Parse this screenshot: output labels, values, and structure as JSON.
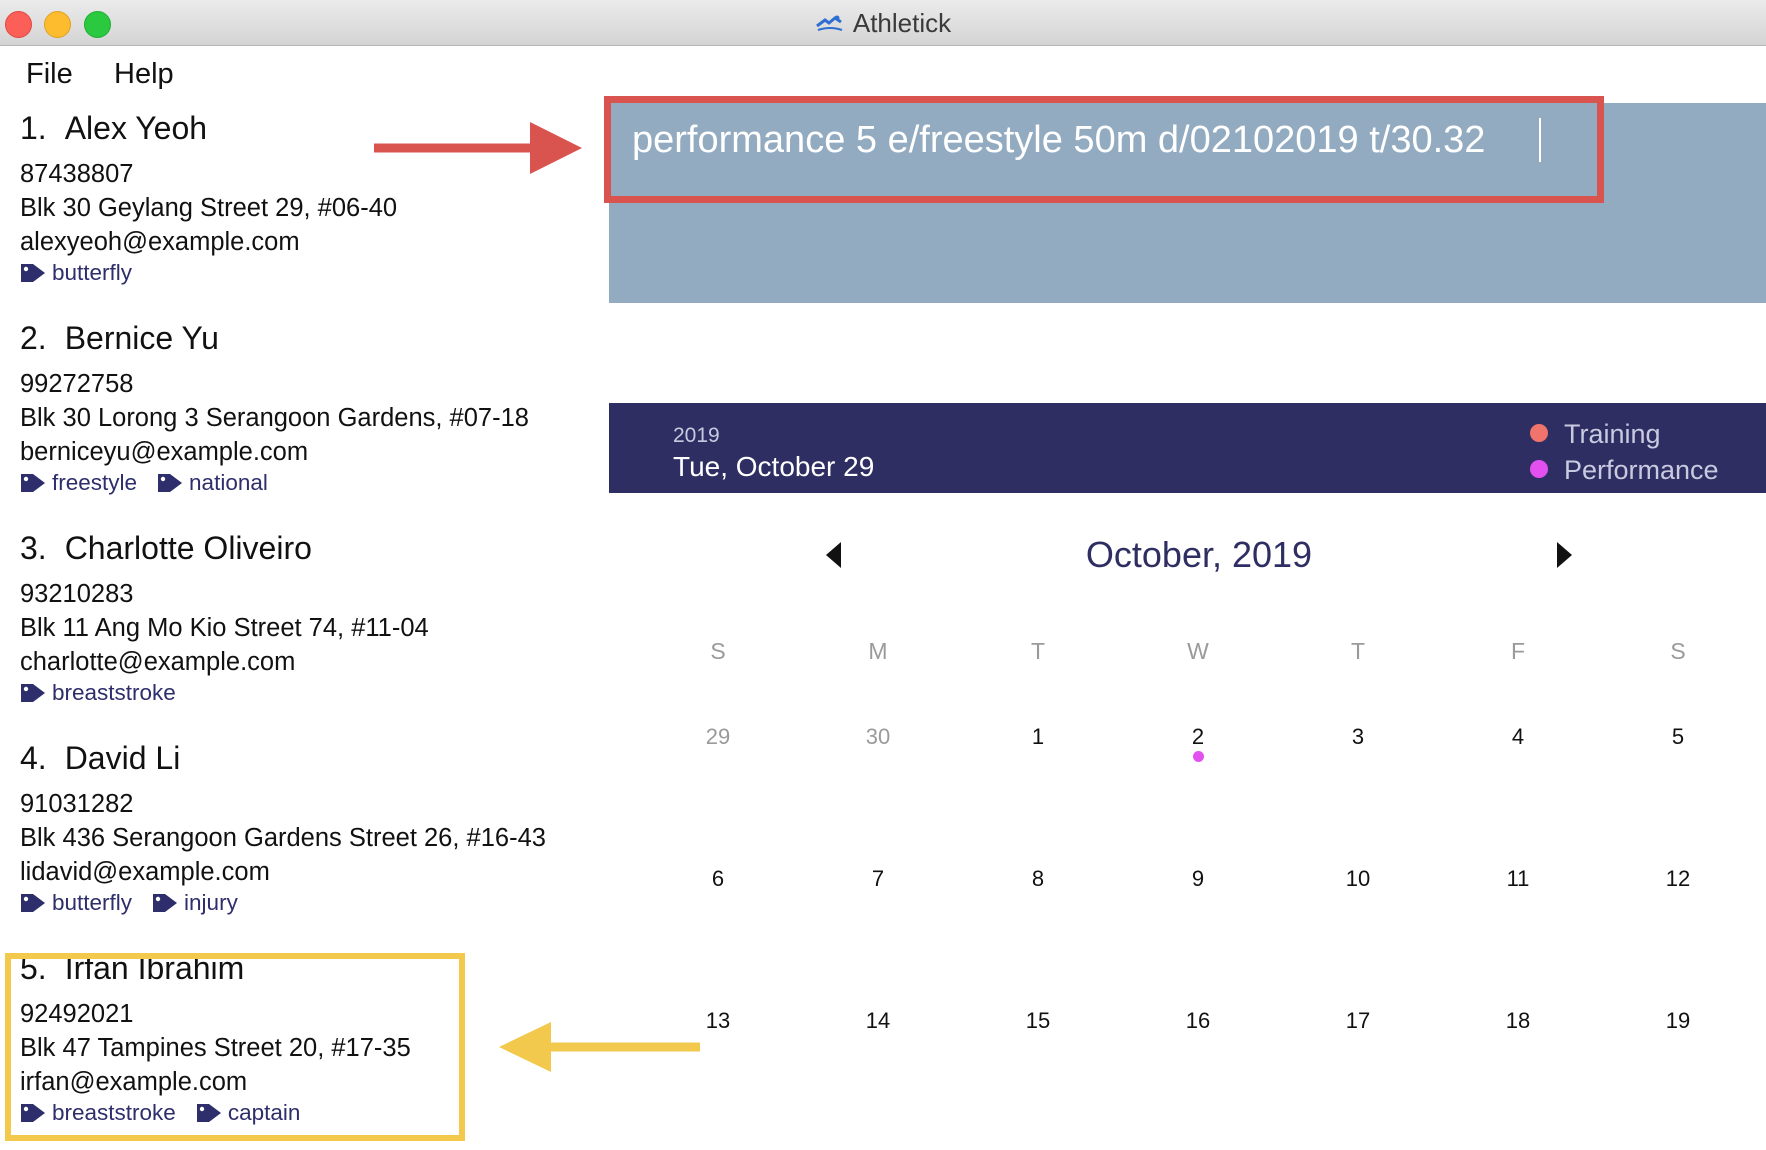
{
  "window": {
    "title": "Athletick"
  },
  "menu": {
    "items": [
      "File",
      "Help"
    ]
  },
  "people": [
    {
      "index": "1.",
      "name": "Alex Yeoh",
      "phone": "87438807",
      "address": "Blk 30 Geylang Street 29, #06-40",
      "email": "alexyeoh@example.com",
      "tags": [
        "butterfly"
      ]
    },
    {
      "index": "2.",
      "name": "Bernice Yu",
      "phone": "99272758",
      "address": "Blk 30 Lorong 3 Serangoon Gardens, #07-18",
      "email": "berniceyu@example.com",
      "tags": [
        "freestyle",
        "national"
      ]
    },
    {
      "index": "3.",
      "name": "Charlotte Oliveiro",
      "phone": "93210283",
      "address": "Blk 11 Ang Mo Kio Street 74, #11-04",
      "email": "charlotte@example.com",
      "tags": [
        "breaststroke"
      ]
    },
    {
      "index": "4.",
      "name": "David Li",
      "phone": "91031282",
      "address": "Blk 436 Serangoon Gardens Street 26, #16-43",
      "email": "lidavid@example.com",
      "tags": [
        "butterfly",
        "injury"
      ]
    },
    {
      "index": "5.",
      "name": "Irfan Ibrahim",
      "phone": "92492021",
      "address": "Blk 47 Tampines Street 20, #17-35",
      "email": "irfan@example.com",
      "tags": [
        "breaststroke",
        "captain"
      ]
    }
  ],
  "command": {
    "value": "performance 5 e/freestyle 50m d/02102019 t/30.32"
  },
  "calendar": {
    "selected_year": "2019",
    "selected_date": "Tue, October 29",
    "legend": [
      {
        "label": "Training",
        "color": "#f0736c"
      },
      {
        "label": "Performance",
        "color": "#e251f0"
      }
    ],
    "month_title": "October, 2019",
    "weekdays": [
      "S",
      "M",
      "T",
      "W",
      "T",
      "F",
      "S"
    ],
    "weeks": [
      [
        "29",
        "30",
        "1",
        "2",
        "3",
        "4",
        "5"
      ],
      [
        "6",
        "7",
        "8",
        "9",
        "10",
        "11",
        "12"
      ],
      [
        "13",
        "14",
        "15",
        "16",
        "17",
        "18",
        "19"
      ]
    ],
    "muted_days": [
      "29",
      "30"
    ],
    "event_days": [
      {
        "day": "2",
        "type": "Performance"
      }
    ]
  },
  "colors": {
    "accent_red": "#d9534f",
    "accent_yellow": "#f2c94c",
    "header_navy": "#2e2e63",
    "command_bg": "#93abc0",
    "tag_text": "#2d2e6b"
  },
  "icons": {
    "tag": "tag-icon",
    "prev": "chevron-left-icon",
    "next": "chevron-right-icon"
  }
}
